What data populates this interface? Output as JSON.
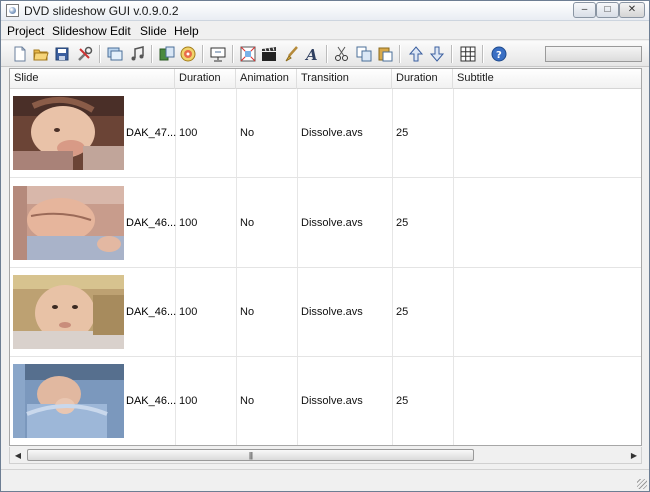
{
  "window": {
    "title": "DVD slideshow GUI v.0.9.0.2"
  },
  "window_controls": {
    "minimize": "–",
    "maximize": "□",
    "close": "✕"
  },
  "menu": [
    "Project",
    "Slideshow",
    "Edit",
    "Slide",
    "Help"
  ],
  "toolbar": {
    "icons": [
      "new-file-icon",
      "open-folder-icon",
      "save-icon",
      "properties-tools-icon",
      "add-pictures-icon",
      "add-music-icon",
      "import-icon",
      "burn-dvd-icon",
      "preview-icon",
      "effects-icon",
      "clapperboard-icon",
      "brush-icon",
      "text-icon",
      "cut-icon",
      "copy-icon",
      "paste-icon",
      "move-up-icon",
      "move-down-icon",
      "grid-icon",
      "help-icon"
    ],
    "progress": 0
  },
  "table": {
    "columns": [
      "Slide",
      "Duration",
      "Animation",
      "Transition",
      "Duration",
      "Subtitle"
    ],
    "rows": [
      {
        "name": "DAK_47...",
        "duration": "100",
        "animation": "No",
        "transition": "Dissolve.avs",
        "transition_duration": "25",
        "subtitle": ""
      },
      {
        "name": "DAK_46...",
        "duration": "100",
        "animation": "No",
        "transition": "Dissolve.avs",
        "transition_duration": "25",
        "subtitle": ""
      },
      {
        "name": "DAK_46...",
        "duration": "100",
        "animation": "No",
        "transition": "Dissolve.avs",
        "transition_duration": "25",
        "subtitle": ""
      },
      {
        "name": "DAK_46...",
        "duration": "100",
        "animation": "No",
        "transition": "Dissolve.avs",
        "transition_duration": "25",
        "subtitle": ""
      }
    ]
  },
  "scrollbar": {
    "left_arrow": "◀",
    "right_arrow": "▶",
    "grip": "|||"
  },
  "colors": {
    "window_border": "#6d7e93",
    "chrome": "#f0f0f0",
    "header_text": "#1b1b1b",
    "progress": "#4fb04f"
  }
}
